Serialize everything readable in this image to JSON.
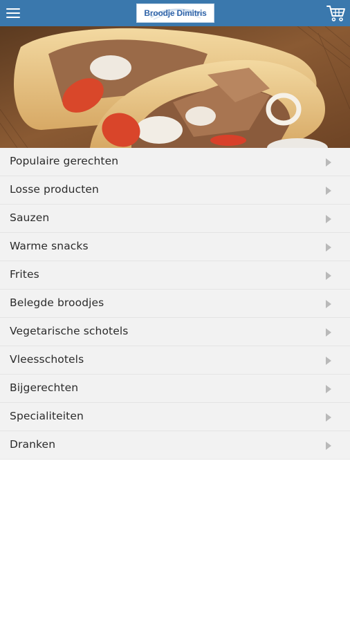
{
  "header": {
    "logo_text": "Broodje Dimitris",
    "menu_icon": "hamburger-menu-icon",
    "cart_icon": "shopping-cart-icon",
    "bar_color": "#3a78ad"
  },
  "hero": {
    "image": "gyros-pita-photo"
  },
  "categories": [
    {
      "label": "Populaire gerechten"
    },
    {
      "label": "Losse producten"
    },
    {
      "label": "Sauzen"
    },
    {
      "label": "Warme snacks"
    },
    {
      "label": "Frites"
    },
    {
      "label": "Belegde broodjes"
    },
    {
      "label": "Vegetarische schotels"
    },
    {
      "label": "Vleesschotels"
    },
    {
      "label": "Bijgerechten"
    },
    {
      "label": "Specialiteiten"
    },
    {
      "label": "Dranken"
    }
  ]
}
